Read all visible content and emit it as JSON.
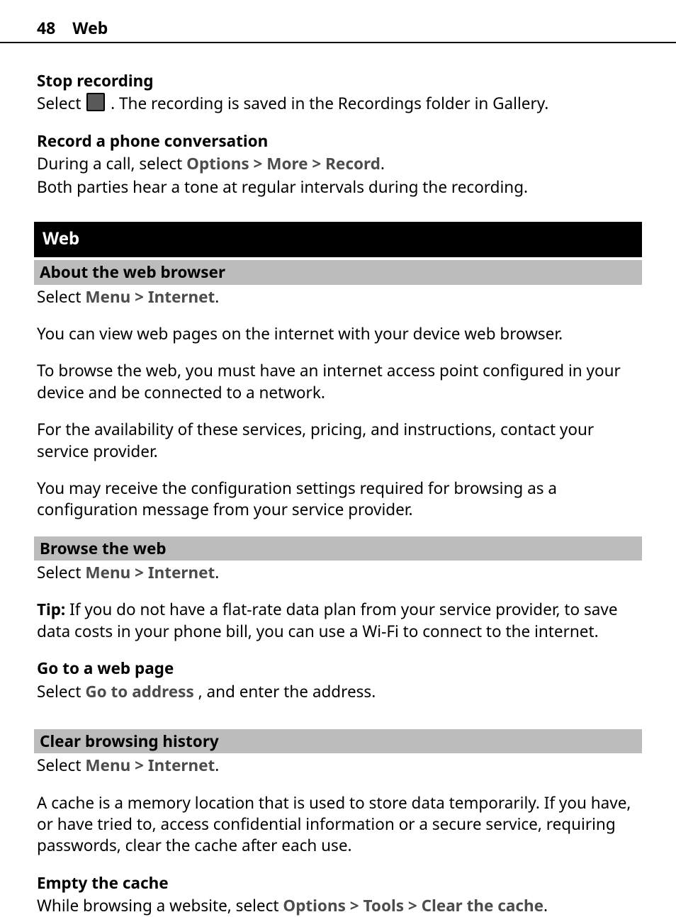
{
  "header": {
    "page_number": "48",
    "running_title": "Web"
  },
  "sections": {
    "stop_recording": {
      "title": "Stop recording",
      "p1_before": "Select ",
      "p1_after": ". The recording is saved in the Recordings folder in Gallery.",
      "icon_name": "stop-icon"
    },
    "record_conv": {
      "title": "Record a phone conversation",
      "line1_lead": "During a call, select ",
      "nav": {
        "a": "Options",
        "b": "More",
        "c": "Record"
      },
      "line2": "Both parties hear a tone at regular intervals during the recording."
    },
    "web_chapter": {
      "title": "Web"
    },
    "about_browser": {
      "title": "About the web browser",
      "select_lead": "Select ",
      "nav": {
        "a": "Menu",
        "b": "Internet"
      },
      "p1": "You can view web pages on the internet with your device web browser.",
      "p2": "To browse the web, you must have an internet access point configured in your device and be connected to a network.",
      "p3": "For the availability of these services, pricing, and instructions, contact your service provider.",
      "p4": "You may receive the configuration settings required for browsing as a configuration message from your service provider."
    },
    "browse_web": {
      "title": "Browse the web",
      "select_lead": "Select ",
      "nav": {
        "a": "Menu",
        "b": "Internet"
      },
      "tip_label": "Tip:",
      "tip_body": " If you do not have a flat-rate data plan from your service provider, to save data costs in your phone bill, you can use a Wi-Fi to connect to the internet."
    },
    "go_page": {
      "title": "Go to a web page",
      "lead": "Select ",
      "action": "Go to address",
      "tail": ", and enter the address."
    },
    "clear_hist": {
      "title": "Clear browsing history",
      "select_lead": "Select ",
      "nav": {
        "a": "Menu",
        "b": "Internet"
      },
      "p1": "A cache is a memory location that is used to store data temporarily. If you have, or have tried to, access confidential information or a secure service, requiring passwords, clear the cache after each use."
    },
    "empty_cache": {
      "title": "Empty the cache",
      "lead": "While browsing a website, select ",
      "nav": {
        "a": "Options",
        "b": "Tools",
        "c": "Clear the cache"
      }
    }
  },
  "chevron": ">"
}
